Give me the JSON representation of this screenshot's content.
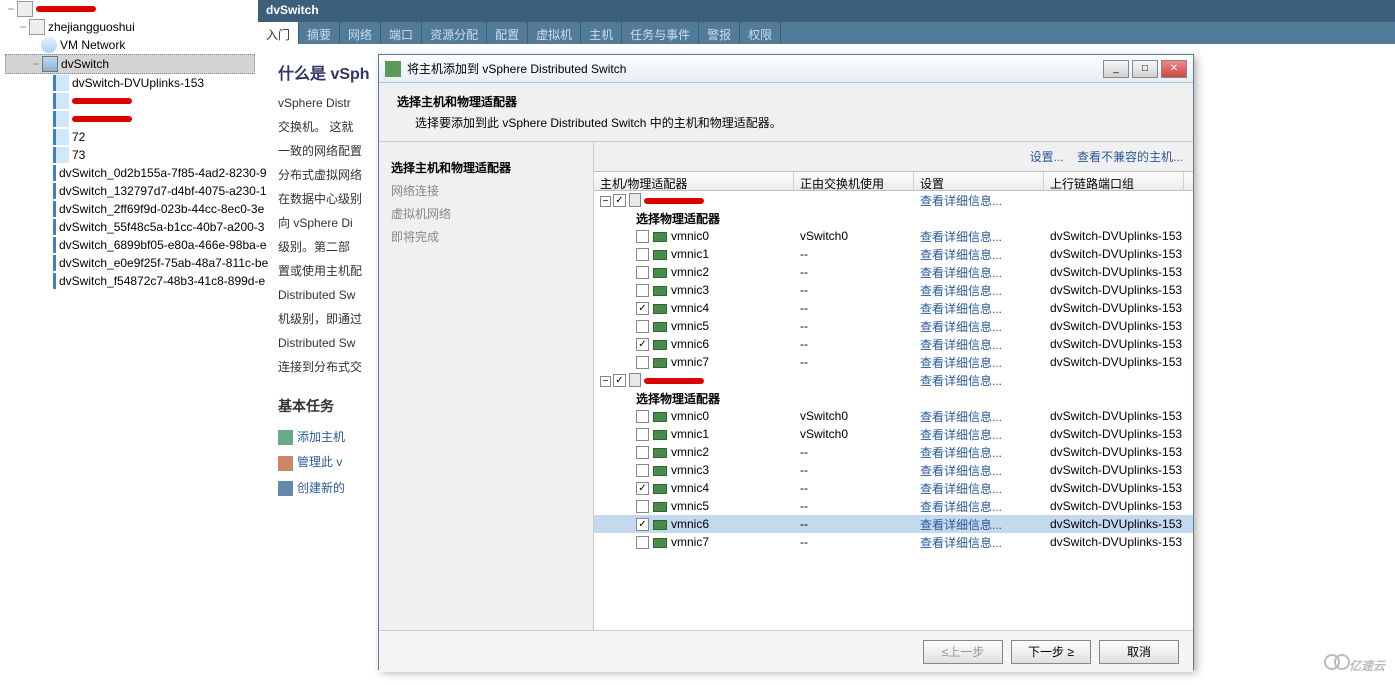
{
  "tree": {
    "root": "zhejiangguoshui",
    "vmnet": "VM Network",
    "dvswitch": "dvSwitch",
    "items": [
      "dvSwitch-DVUplinks-153",
      "",
      "",
      "72",
      "73",
      "dvSwitch_0d2b155a-7f85-4ad2-8230-9",
      "dvSwitch_132797d7-d4bf-4075-a230-1",
      "dvSwitch_2ff69f9d-023b-44cc-8ec0-3e",
      "dvSwitch_55f48c5a-b1cc-40b7-a200-3",
      "dvSwitch_6899bf05-e80a-466e-98ba-e",
      "dvSwitch_e0e9f25f-75ab-48a7-811c-be",
      "dvSwitch_f54872c7-48b3-41c8-899d-e"
    ]
  },
  "main": {
    "title": "dvSwitch",
    "tabs": [
      "入门",
      "摘要",
      "网络",
      "端口",
      "资源分配",
      "配置",
      "虚拟机",
      "主机",
      "任务与事件",
      "警报",
      "权限"
    ],
    "heading": "什么是 vSph",
    "p1": "vSphere Distr",
    "p2": "交换机。 这就",
    "p3": "一致的网络配置",
    "p4": "分布式虚拟网络",
    "p5": "在数据中心级别",
    "p6": "向 vSphere Di",
    "p7": "级别。第二部",
    "p8": "置或使用主机配",
    "p9": "Distributed Sw",
    "p10": "机级别，即通过",
    "p11": "Distributed Sw",
    "p12": "连接到分布式交",
    "tasks_h": "基本任务",
    "task1": "添加主机",
    "task2": "管理此 v",
    "task3": "创建新的"
  },
  "dialog": {
    "title": "将主机添加到 vSphere Distributed Switch",
    "sub1": "选择主机和物理适配器",
    "sub2": "选择要添加到此 vSphere Distributed Switch 中的主机和物理适配器。",
    "steps": [
      "选择主机和物理适配器",
      "网络连接",
      "虚拟机网络",
      "即将完成"
    ],
    "settings": "设置...",
    "view_incomp": "查看不兼容的主机...",
    "cols": [
      "主机/物理适配器",
      "正由交换机使用",
      "设置",
      "上行链路端口组"
    ],
    "hosts": [
      {
        "label": "选择物理适配器",
        "nics": [
          {
            "name": "vmnic0",
            "sw": "vSwitch0",
            "det": "查看详细信息...",
            "up": "dvSwitch-DVUplinks-153",
            "chk": false
          },
          {
            "name": "vmnic1",
            "sw": "--",
            "det": "查看详细信息...",
            "up": "dvSwitch-DVUplinks-153",
            "chk": false
          },
          {
            "name": "vmnic2",
            "sw": "--",
            "det": "查看详细信息...",
            "up": "dvSwitch-DVUplinks-153",
            "chk": false
          },
          {
            "name": "vmnic3",
            "sw": "--",
            "det": "查看详细信息...",
            "up": "dvSwitch-DVUplinks-153",
            "chk": false
          },
          {
            "name": "vmnic4",
            "sw": "--",
            "det": "查看详细信息...",
            "up": "dvSwitch-DVUplinks-153",
            "chk": true
          },
          {
            "name": "vmnic5",
            "sw": "--",
            "det": "查看详细信息...",
            "up": "dvSwitch-DVUplinks-153",
            "chk": false
          },
          {
            "name": "vmnic6",
            "sw": "--",
            "det": "查看详细信息...",
            "up": "dvSwitch-DVUplinks-153",
            "chk": true
          },
          {
            "name": "vmnic7",
            "sw": "--",
            "det": "查看详细信息...",
            "up": "dvSwitch-DVUplinks-153",
            "chk": false
          }
        ]
      },
      {
        "label": "选择物理适配器",
        "nics": [
          {
            "name": "vmnic0",
            "sw": "vSwitch0",
            "det": "查看详细信息...",
            "up": "dvSwitch-DVUplinks-153",
            "chk": false
          },
          {
            "name": "vmnic1",
            "sw": "vSwitch0",
            "det": "查看详细信息...",
            "up": "dvSwitch-DVUplinks-153",
            "chk": false
          },
          {
            "name": "vmnic2",
            "sw": "--",
            "det": "查看详细信息...",
            "up": "dvSwitch-DVUplinks-153",
            "chk": false
          },
          {
            "name": "vmnic3",
            "sw": "--",
            "det": "查看详细信息...",
            "up": "dvSwitch-DVUplinks-153",
            "chk": false
          },
          {
            "name": "vmnic4",
            "sw": "--",
            "det": "查看详细信息...",
            "up": "dvSwitch-DVUplinks-153",
            "chk": true
          },
          {
            "name": "vmnic5",
            "sw": "--",
            "det": "查看详细信息...",
            "up": "dvSwitch-DVUplinks-153",
            "chk": false
          },
          {
            "name": "vmnic6",
            "sw": "--",
            "det": "查看详细信息...",
            "up": "dvSwitch-DVUplinks-153",
            "chk": true,
            "sel": true
          },
          {
            "name": "vmnic7",
            "sw": "--",
            "det": "查看详细信息...",
            "up": "dvSwitch-DVUplinks-153",
            "chk": false
          }
        ]
      }
    ],
    "host_detail": "查看详细信息...",
    "back": "≤上一步",
    "next": "下一步 ≥",
    "cancel": "取消"
  },
  "watermark": "亿速云"
}
